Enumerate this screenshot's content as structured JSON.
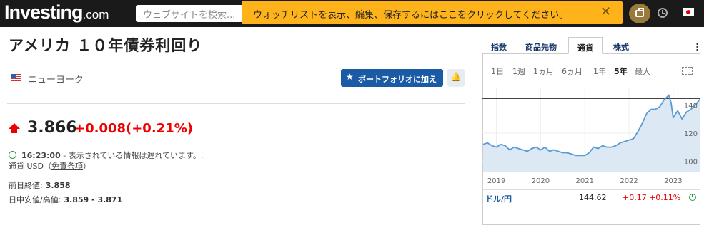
{
  "header": {
    "logo_main": "Investing",
    "logo_suffix": ".com",
    "search_placeholder": "ウェブサイトを検索...",
    "banner_text": "ウォッチリストを表示、編集、保存するにはここをクリックしてください。",
    "banner_close": "✕"
  },
  "instrument": {
    "title": "アメリカ １０年債券利回り",
    "exchange": "ニューヨーク",
    "add_portfolio_label": "ポートフォリオに加える",
    "price": "3.866",
    "change": "+0.008",
    "change_pct": "(+0.21%)",
    "time": "16:23:00",
    "delay_note": " - 表示されている情報は遅れています。.",
    "currency_label": "通貨 USD（",
    "disclaimer": "免責条項",
    "currency_close": "）",
    "prev_close_label": "前日終値:",
    "prev_close_value": "3.858",
    "day_range_label": "日中安値/高値:",
    "day_range_value": "3.859 - 3.871"
  },
  "side": {
    "tabs": [
      "指数",
      "商品先物",
      "通貨",
      "株式"
    ],
    "active_tab": 2,
    "ranges": [
      "1日",
      "1週",
      "1ヵ月",
      "6ヵ月",
      "1年",
      "5年",
      "最大"
    ],
    "active_range": 5,
    "pair": {
      "name": "ドル/円",
      "value": "144.62",
      "change": "+0.17",
      "change_pct": "+0.11%"
    }
  },
  "chart_data": {
    "type": "area",
    "x": [
      2018.7,
      2018.8,
      2018.9,
      2019.0,
      2019.1,
      2019.2,
      2019.3,
      2019.4,
      2019.5,
      2019.6,
      2019.7,
      2019.8,
      2019.9,
      2020.0,
      2020.1,
      2020.2,
      2020.3,
      2020.4,
      2020.5,
      2020.6,
      2020.7,
      2020.8,
      2020.9,
      2021.0,
      2021.1,
      2021.2,
      2021.3,
      2021.4,
      2021.5,
      2021.6,
      2021.7,
      2021.8,
      2021.9,
      2022.0,
      2022.1,
      2022.2,
      2022.3,
      2022.4,
      2022.5,
      2022.6,
      2022.7,
      2022.8,
      2022.9,
      2022.95,
      2023.0,
      2023.1,
      2023.2,
      2023.3,
      2023.4,
      2023.5,
      2023.6
    ],
    "y": [
      112,
      113,
      111,
      110,
      112,
      111,
      108,
      110,
      109,
      108,
      107,
      109,
      110,
      108,
      110,
      107,
      108,
      107,
      106,
      106,
      105,
      104,
      104,
      104,
      106,
      110,
      109,
      111,
      110,
      110,
      111,
      113,
      114,
      115,
      116,
      121,
      127,
      134,
      137,
      137,
      139,
      144,
      147,
      142,
      131,
      136,
      130,
      135,
      137,
      140,
      144
    ],
    "xticks": [
      "2019",
      "2020",
      "2021",
      "2022",
      "2023"
    ],
    "xtick_values": [
      2019,
      2020,
      2021,
      2022,
      2023
    ],
    "yticks": [
      100,
      120,
      140
    ],
    "ylim": [
      92,
      152
    ],
    "xlim": [
      2018.7,
      2023.6
    ],
    "colors": {
      "line": "#5a9bd5",
      "fill": "#dce8f4",
      "ref": "#444444"
    },
    "ref_line": 144.62
  }
}
